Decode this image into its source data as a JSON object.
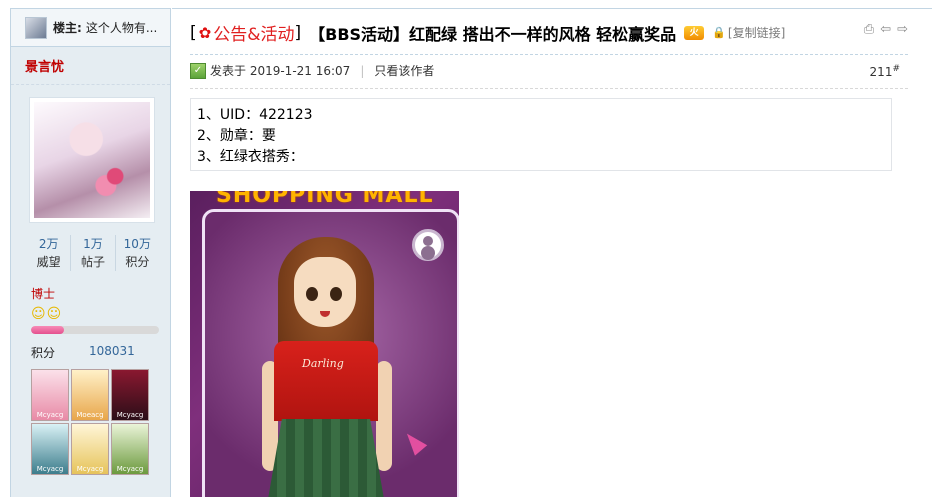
{
  "sidebar": {
    "op_label": "楼主:",
    "op_name": "这个人物有...",
    "username": "景言忧",
    "stats": [
      {
        "num": "2万",
        "label": "威望"
      },
      {
        "num": "1万",
        "label": "帖子"
      },
      {
        "num": "10万",
        "label": "积分"
      }
    ],
    "rank": "博士",
    "smileys": "☺☺",
    "level_progress_percent": 26,
    "points_label": "积分",
    "points_value": "108031",
    "medal_captions": [
      "Mcyacg",
      "Moeacg",
      "Mcyacg",
      "Mcyacg",
      "Mcyacg",
      "Mcyacg"
    ]
  },
  "post": {
    "flower": "✿",
    "category": "公告&活动",
    "title": "【BBS活动】红配绿 搭出不一样的风格 轻松赢奖品",
    "hot_badge": "火",
    "copy_link": "[复制链接]",
    "posted_at": "发表于 2019-1-21 16:07",
    "only_author": "只看该作者",
    "floor_number": "211",
    "floor_mark": "#",
    "content_lines": [
      "1、UID：422123",
      "2、勋章：要",
      "3、红绿衣搭秀："
    ],
    "image_banner": "SHOPPING MALL",
    "shirt_text": "Darling"
  }
}
